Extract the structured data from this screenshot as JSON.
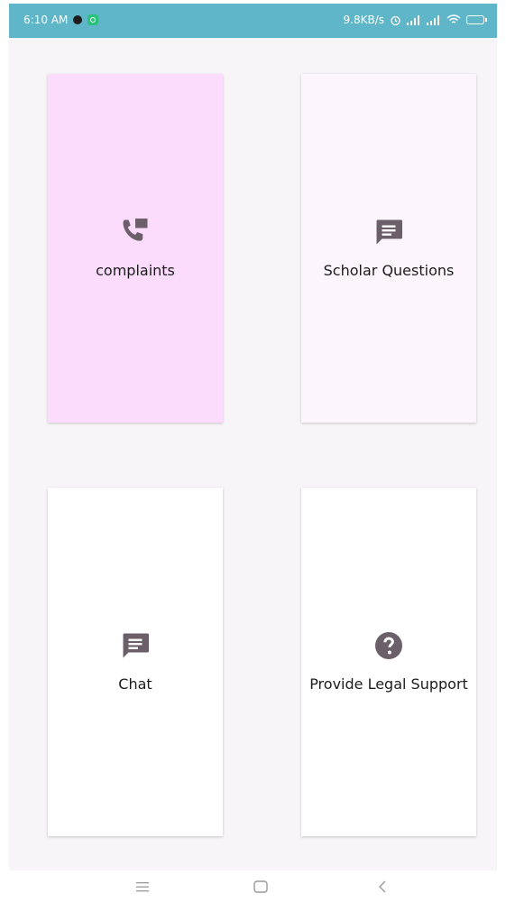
{
  "status_bar": {
    "time": "6:10 AM",
    "network_speed": "9.8KB/s",
    "icons": [
      "record-dot-icon",
      "app-notification-icon",
      "alarm-icon",
      "signal-1-icon",
      "signal-2-icon",
      "wifi-icon",
      "battery-icon"
    ]
  },
  "cards": [
    {
      "label": "complaints",
      "icon": "phone-forward-icon",
      "background": "#fcdcfc"
    },
    {
      "label": "Scholar Questions",
      "icon": "message-icon",
      "background": "#fdf5fc"
    },
    {
      "label": "Chat",
      "icon": "message-icon",
      "background": "#ffffff"
    },
    {
      "label": "Provide Legal Support",
      "icon": "help-circle-icon",
      "background": "#ffffff"
    }
  ],
  "nav_bar": {
    "icons": [
      "menu-icon",
      "home-icon",
      "back-icon"
    ]
  },
  "colors": {
    "status_bar": "#5fb6c8",
    "icon_tint": "#6b5f6a",
    "page_background": "#f7f5f8"
  }
}
